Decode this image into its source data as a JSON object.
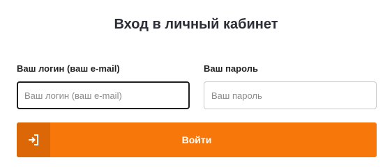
{
  "form": {
    "title": "Вход в личный кабинет",
    "login": {
      "label": "Ваш логин (ваш e-mail)",
      "placeholder": "Ваш логин (ваш e-mail)",
      "value": ""
    },
    "password": {
      "label": "Ваш пароль",
      "placeholder": "Ваш пароль",
      "value": ""
    },
    "submit": {
      "label": "Войти",
      "icon": "sign-in-icon"
    },
    "colors": {
      "accent": "#f7770b",
      "accent_dark": "#dc6707",
      "title": "#2b2e36"
    }
  }
}
